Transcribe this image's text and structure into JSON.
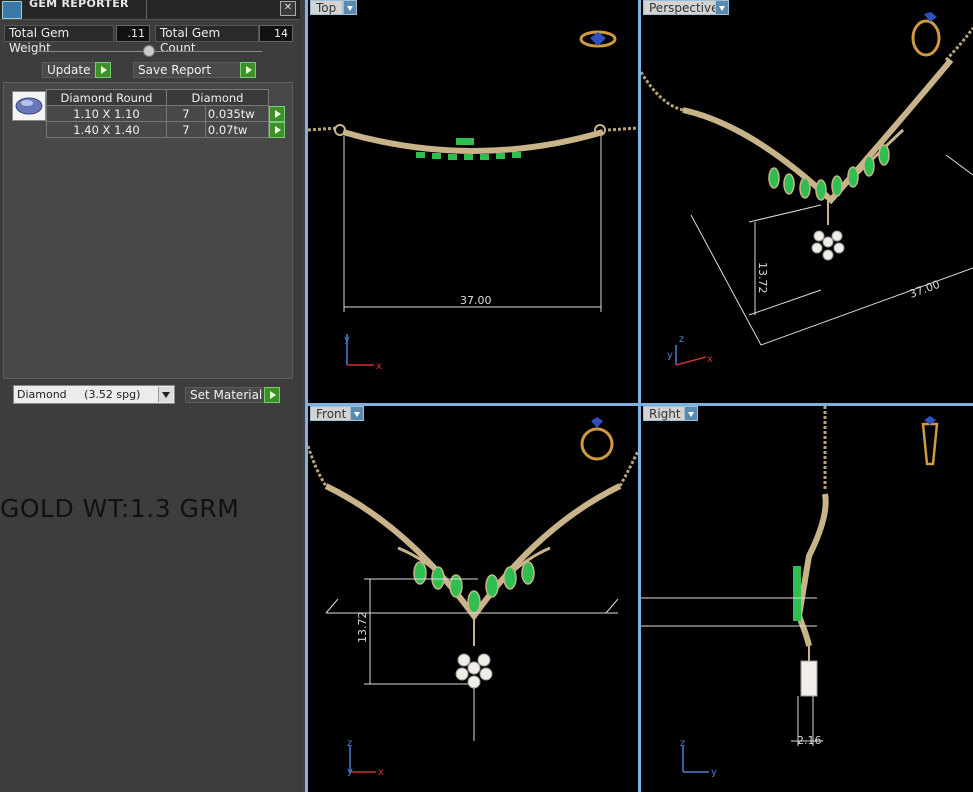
{
  "panel": {
    "title": "GEM REPORTER",
    "close_glyph": "✕",
    "total_weight_label": "Total Gem Weight",
    "total_weight_value": ".11",
    "total_count_label": "Total Gem Count",
    "total_count_value": "14",
    "update_label": "Update",
    "save_report_label": "Save Report",
    "table_headers": [
      "Diamond Round",
      "Diamond"
    ],
    "rows": [
      {
        "size": "1.10 X 1.10",
        "count": "7",
        "weight": "0.035tw"
      },
      {
        "size": "1.40 X 1.40",
        "count": "7",
        "weight": "0.07tw"
      }
    ],
    "material_selected": "Diamond     (3.52 spg)",
    "set_material_label": "Set Material"
  },
  "annotation": {
    "gold_weight": "GOLD WT:1.3 GRM"
  },
  "viewports": {
    "top": {
      "label": "Top",
      "dims": [
        "37.00"
      ]
    },
    "perspective": {
      "label": "Perspective",
      "dims": [
        "13.72",
        "37.00"
      ]
    },
    "front": {
      "label": "Front",
      "dims": [
        "13.72"
      ]
    },
    "right": {
      "label": "Right",
      "dims": [
        "2.16"
      ]
    }
  },
  "axes": {
    "x": "x",
    "y": "y",
    "z": "z"
  },
  "colors": {
    "gold": "#c9b48a",
    "emerald": "#2fbf50",
    "viewport_border": "#7fb2dc",
    "go_button": "#3d8f28"
  },
  "icons": [
    "gem-reporter-app-icon",
    "close-icon",
    "go-arrow-icon",
    "dropdown-arrow-icon",
    "ring-widget-icon",
    "diamond-thumbnail"
  ]
}
